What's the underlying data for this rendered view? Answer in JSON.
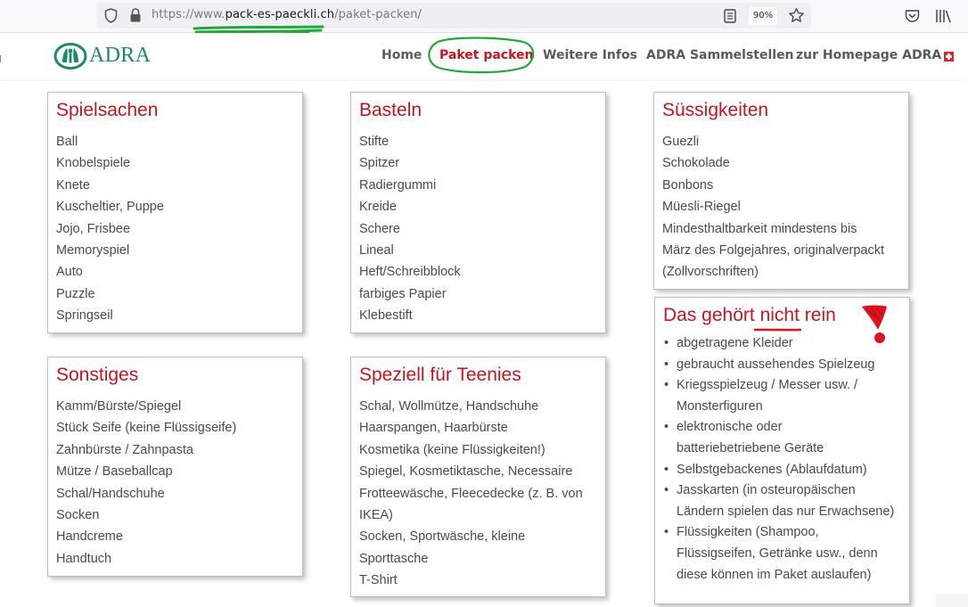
{
  "browser": {
    "url_prefix": "https://www.",
    "url_host": "pack-es-paeckli.ch",
    "url_path": "/paket-packen/",
    "zoom": "90%",
    "icons": [
      "shield-icon",
      "lock-icon",
      "reader-view-icon",
      "bookmark-star-icon",
      "pocket-icon",
      "library-icon"
    ]
  },
  "header": {
    "logo_text": "ADRA",
    "nav": [
      {
        "label": "Home",
        "active": false
      },
      {
        "label": "Paket packen",
        "active": true
      },
      {
        "label": "Weitere Infos",
        "active": false
      },
      {
        "label": "ADRA Sammelstellen",
        "active": false
      },
      {
        "label": "zur Homepage ADRA",
        "active": false
      }
    ],
    "flag_icon": "swiss-flag-icon"
  },
  "colors": {
    "accent_red": "#c6151f",
    "logo_green": "#1c8a66",
    "annotation_green": "#22a83a",
    "annotation_red": "#e1121f"
  },
  "cards": {
    "spielsachen": {
      "title": "Spielsachen",
      "items": [
        "Ball",
        "Knobelspiele",
        "Knete",
        "Kuscheltier, Puppe",
        "Jojo, Frisbee",
        "Memoryspiel",
        "Auto",
        "Puzzle",
        "Springseil"
      ]
    },
    "basteln": {
      "title": "Basteln",
      "items": [
        "Stifte",
        "Spitzer",
        "Radiergummi",
        "Kreide",
        "Schere",
        "Lineal",
        "Heft/Schreibblock",
        "farbiges Papier",
        "Klebestift"
      ]
    },
    "suessigkeiten": {
      "title": "Süssigkeiten",
      "items": [
        "Guezli",
        "Schokolade",
        "Bonbons",
        "Müesli-Riegel",
        "Mindesthaltbarkeit mindestens bis",
        "März des Folgejahres, originalverpackt",
        "(Zollvorschriften)"
      ]
    },
    "sonstiges": {
      "title": "Sonstiges",
      "items": [
        "Kamm/Bürste/Spiegel",
        "Stück Seife (keine Flüssigseife)",
        "Zahnbürste / Zahnpasta",
        "Mütze / Baseballcap",
        "Schal/Handschuhe",
        "Socken",
        "Handcreme",
        "Handtuch"
      ]
    },
    "teenies": {
      "title": "Speziell für Teenies",
      "items": [
        "Schal, Wollmütze, Handschuhe",
        "Haarspangen, Haarbürste",
        "Kosmetika (keine Flüssigkeiten!)",
        "Spiegel, Kosmetiktasche, Necessaire",
        "Frotteewäsche, Fleecedecke (z. B. von",
        "IKEA)",
        "Socken, Sportwäsche, kleine",
        "Sporttasche",
        "T-Shirt"
      ]
    },
    "nicht_rein": {
      "title_before": "Das gehört ",
      "title_emph": "nicht ",
      "title_after": "rein",
      "items": [
        {
          "lines": [
            "abgetragene Kleider"
          ]
        },
        {
          "lines": [
            "gebraucht aussehendes Spielzeug"
          ]
        },
        {
          "lines": [
            "Kriegsspielzeug / Messer usw. /",
            "Monsterfiguren"
          ]
        },
        {
          "lines": [
            "elektronische oder",
            "batteriebetriebene Geräte"
          ]
        },
        {
          "lines": [
            "Selbstgebackenes (Ablaufdatum)"
          ]
        },
        {
          "lines": [
            "Jasskarten (in osteuropäischen",
            "Ländern spielen das nur Erwachsene)"
          ]
        },
        {
          "lines": [
            "Flüssigkeiten (Shampoo,",
            "Flüssigseifen, Getränke usw., denn",
            "diese können im Paket auslaufen)"
          ]
        }
      ]
    }
  }
}
